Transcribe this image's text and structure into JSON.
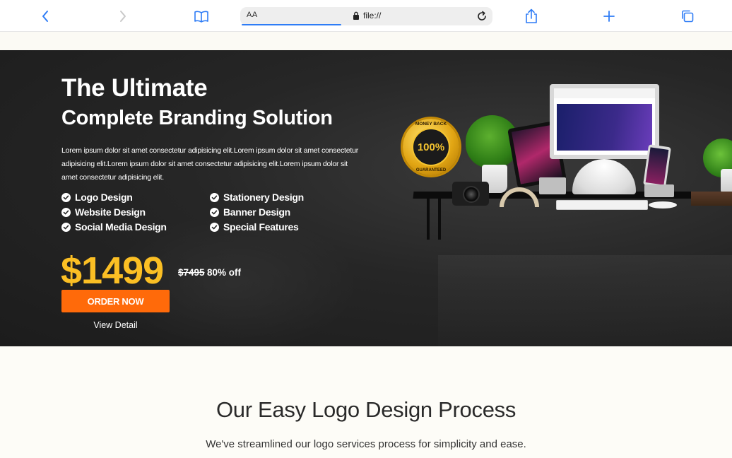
{
  "browser": {
    "text_size_label": "AA",
    "url": "file://",
    "icons": {
      "back": "chevron-left-icon",
      "forward": "chevron-right-icon",
      "reader": "book-icon",
      "lock": "lock-icon",
      "reload": "reload-icon",
      "share": "share-icon",
      "new_tab": "plus-icon",
      "tabs": "tabs-icon"
    },
    "accent_color": "#2e7cf6"
  },
  "hero": {
    "title_line1": "The Ultimate",
    "title_line2": "Complete Branding Solution",
    "description": "Lorem ipsum dolor sit amet consectetur adipisicing elit.Lorem ipsum dolor sit amet consectetur adipisicing elit.Lorem ipsum dolor sit amet consectetur adipisicing elit.Lorem ipsum dolor sit amet consectetur adipisicing elit.",
    "features": [
      "Logo Design",
      "Stationery Design",
      "Website Design",
      "Banner Design",
      "Social Media Design",
      "Special Features"
    ],
    "price": "$1499",
    "old_price": "$7495",
    "discount": "80% off",
    "order_button": "ORDER NOW",
    "view_detail": "View Detail",
    "price_color": "#fbbf24",
    "button_color": "#ff6a0a"
  },
  "illustration": {
    "badge_top": "MONEY BACK",
    "badge_percent": "100%",
    "badge_bottom": "GUARANTEED"
  },
  "process_section": {
    "title": "Our Easy Logo Design Process",
    "subtitle": "We've streamlined our logo services process for simplicity and ease."
  }
}
